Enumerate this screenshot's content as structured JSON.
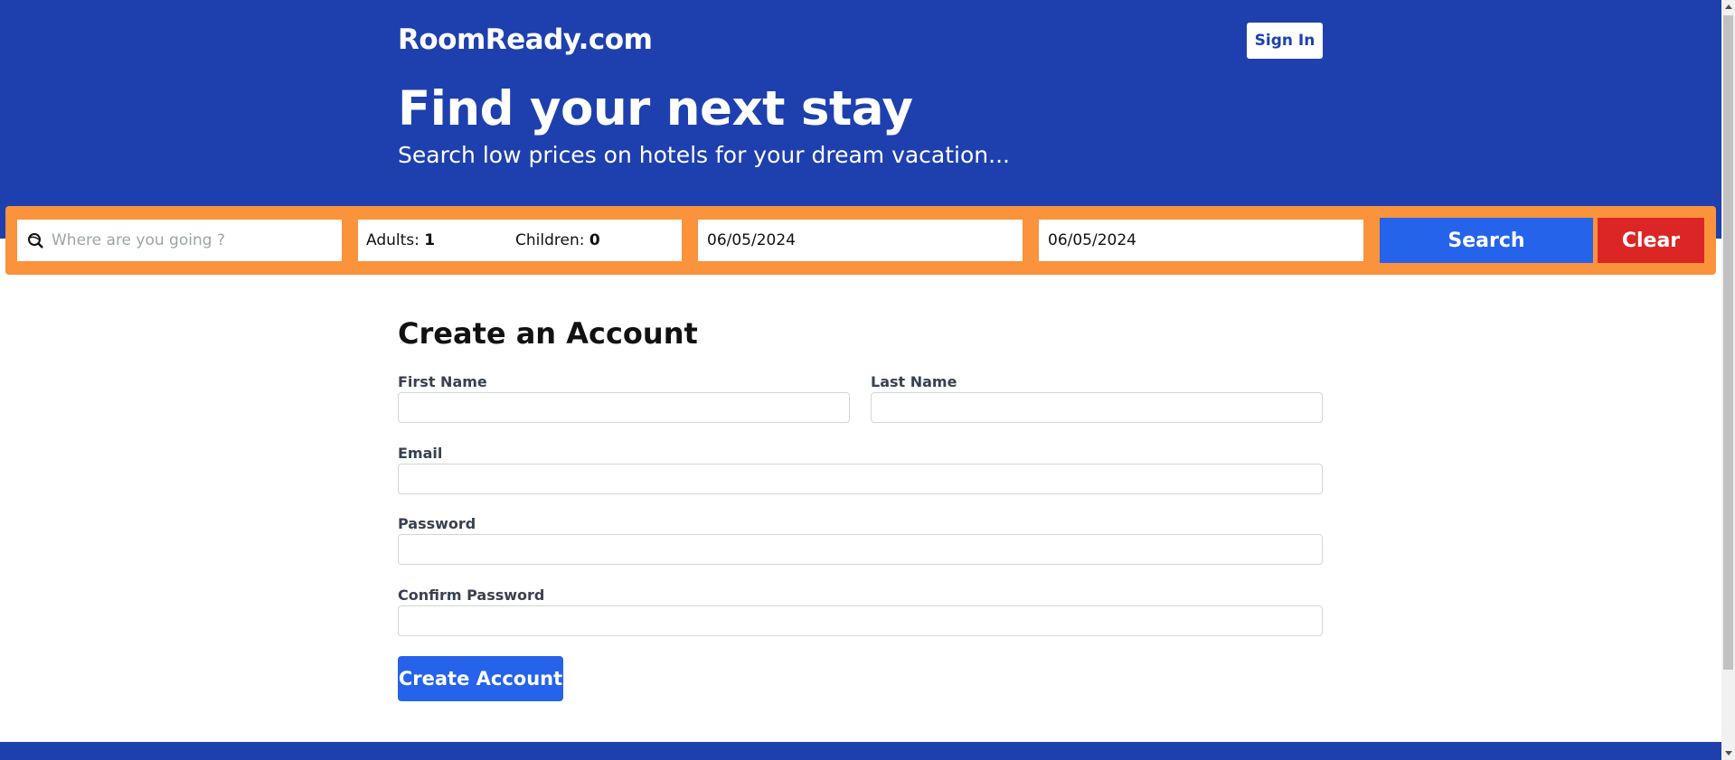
{
  "header": {
    "brand": "RoomReady.com",
    "sign_in_label": "Sign In",
    "hero_title": "Find your next stay",
    "hero_subtitle": "Search low prices on hotels for your dream vacation..."
  },
  "search": {
    "destination_placeholder": "Where are you going ?",
    "destination_icon": "globe-search-icon",
    "adults_label": "Adults:",
    "adults_value": "1",
    "children_label": "Children:",
    "children_value": "0",
    "check_in": "06/05/2024",
    "check_out": "06/05/2024",
    "search_label": "Search",
    "clear_label": "Clear"
  },
  "form": {
    "title": "Create an Account",
    "first_name_label": "First Name",
    "last_name_label": "Last Name",
    "email_label": "Email",
    "password_label": "Password",
    "confirm_password_label": "Confirm Password",
    "submit_label": "Create Account"
  },
  "colors": {
    "header_bg": "#1e40af",
    "search_bar_bg": "#fb923c",
    "primary_button": "#2563eb",
    "clear_button": "#dc2626"
  }
}
